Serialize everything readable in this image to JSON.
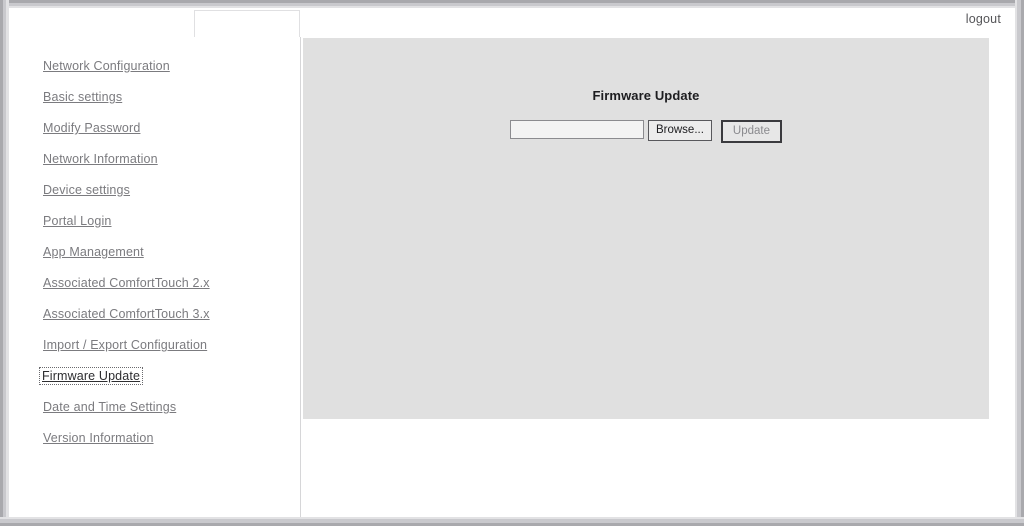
{
  "window": {
    "frame_color": "#a9a9ad",
    "background": "#ffffff"
  },
  "header": {
    "logout_label": "logout"
  },
  "tabs": {
    "items": [
      {
        "label": "",
        "selected": true
      }
    ]
  },
  "sidebar": {
    "items": [
      {
        "label": "Network Configuration",
        "selected": false
      },
      {
        "label": "Basic settings",
        "selected": false
      },
      {
        "label": "Modify Password",
        "selected": false
      },
      {
        "label": "Network Information",
        "selected": false
      },
      {
        "label": "Device settings",
        "selected": false
      },
      {
        "label": "Portal Login",
        "selected": false
      },
      {
        "label": "App Management",
        "selected": false
      },
      {
        "label": "Associated ComfortTouch 2.x",
        "selected": false
      },
      {
        "label": "Associated ComfortTouch 3.x",
        "selected": false
      },
      {
        "label": "Import / Export Configuration",
        "selected": false
      },
      {
        "label": "Firmware Update",
        "selected": true
      },
      {
        "label": "Date and Time Settings",
        "selected": false
      },
      {
        "label": "Version Information",
        "selected": false
      }
    ]
  },
  "main": {
    "panel_background": "#e0e0e0",
    "title": "Firmware Update",
    "form": {
      "file_value": "",
      "file_placeholder": "",
      "browse_label": "Browse...",
      "update_label": "Update"
    }
  }
}
